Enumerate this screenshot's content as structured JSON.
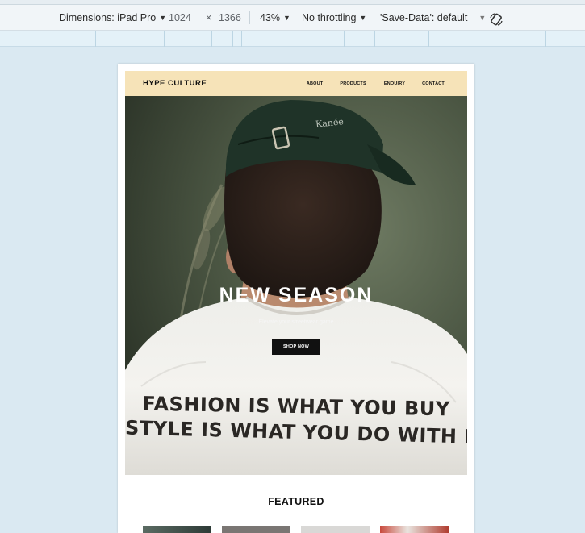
{
  "devtools": {
    "dimensions_label": "Dimensions: iPad Pro",
    "width_value": "1024",
    "times_symbol": "×",
    "height_value": "1366",
    "zoom": "43%",
    "throttling": "No throttling",
    "save_data": "'Save-Data': default"
  },
  "site": {
    "brand": "HYPE CULTURE",
    "nav": [
      "ABOUT",
      "PRODUCTS",
      "ENQUIRY",
      "CONTACT"
    ],
    "hero": {
      "title": "NEW SEASON",
      "subtitle": "Elevate your streetwear game",
      "button": "SHOP NOW",
      "cap_text": "Kanée",
      "shirt_line1": "FASHION IS WHAT YOU BUY",
      "shirt_line2": "STYLE IS WHAT YOU DO WITH IT"
    },
    "featured_heading": "FEATURED"
  },
  "colors": {
    "header_bg": "#f6e3b8",
    "button_bg": "#111111",
    "canvas_bg": "#dae9f2"
  }
}
